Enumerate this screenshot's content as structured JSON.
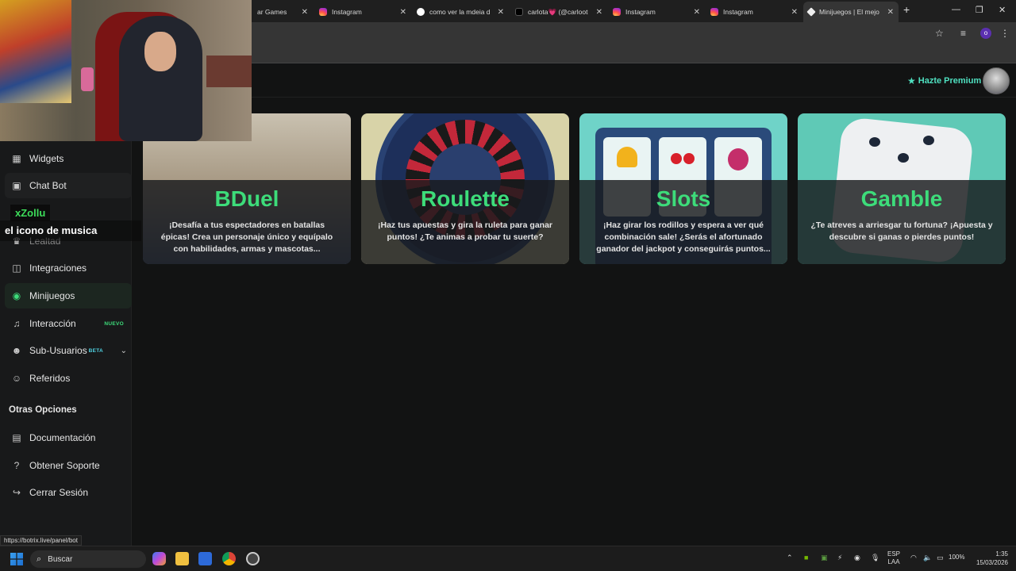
{
  "tabs": [
    {
      "title": "ar Games",
      "icon": "game-icon"
    },
    {
      "title": "Instagram",
      "icon": "instagram-icon"
    },
    {
      "title": "como ver la mdeia de",
      "icon": "google-icon"
    },
    {
      "title": "carlota💗 (@carlootu",
      "icon": "tiktok-icon"
    },
    {
      "title": "Instagram",
      "icon": "instagram-icon"
    },
    {
      "title": "Instagram",
      "icon": "instagram-icon"
    },
    {
      "title": "Minijuegos | El mejor",
      "icon": "botrix-icon"
    }
  ],
  "browser": {
    "new_tab": "+",
    "profile_initial": "o"
  },
  "header": {
    "premium_label": "Hazte Premium"
  },
  "sidebar": {
    "items": [
      {
        "label": "Widgets",
        "icon": "widgets-icon"
      },
      {
        "label": "Chat Bot",
        "icon": "chat-bot-icon"
      },
      {
        "label": "Lealtad",
        "icon": "trophy-icon"
      },
      {
        "label": "Integraciones",
        "icon": "integrations-icon"
      },
      {
        "label": "Minijuegos",
        "icon": "gamepad-icon"
      },
      {
        "label": "Interacción",
        "icon": "music-icon",
        "badge": "NUEVO"
      },
      {
        "label": "Sub-Usuarios",
        "icon": "users-icon",
        "badge": "BETA"
      },
      {
        "label": "Referidos",
        "icon": "referrals-icon"
      }
    ],
    "section_title": "Otras Opciones",
    "other_items": [
      {
        "label": "Documentación",
        "icon": "document-icon"
      },
      {
        "label": "Obtener Soporte",
        "icon": "help-icon"
      },
      {
        "label": "Cerrar Sesión",
        "icon": "logout-icon"
      }
    ]
  },
  "cards": [
    {
      "title": "BDuel",
      "description": "¡Desafía a tus espectadores en batallas épicas! Crea un personaje único y equípalo con habilidades, armas y mascotas..."
    },
    {
      "title": "Roulette",
      "description": "¡Haz tus apuestas y gira la ruleta para ganar puntos! ¿Te animas a probar tu suerte?"
    },
    {
      "title": "Slots",
      "description": "¡Haz girar los rodillos y espera a ver qué combinación sale! ¿Serás el afortunado ganador del jackpot y conseguirás puntos..."
    },
    {
      "title": "Gamble",
      "description": "¿Te atreves a arriesgar tu fortuna? ¡Apuesta y descubre si ganas o pierdes puntos!"
    }
  ],
  "stream_overlay": {
    "streamer_name": "xZollu",
    "caption": "el icono de musica"
  },
  "status_url": "https://botrix.live/panel/bot",
  "taskbar": {
    "search_placeholder": "Buscar",
    "language": "ESP",
    "layout": "LAA",
    "battery": "100%",
    "time": "1:35",
    "date": "15/03/2026"
  },
  "colors": {
    "accent_green": "#3ddc7a",
    "premium": "#4fe0c0",
    "background": "#121313"
  }
}
